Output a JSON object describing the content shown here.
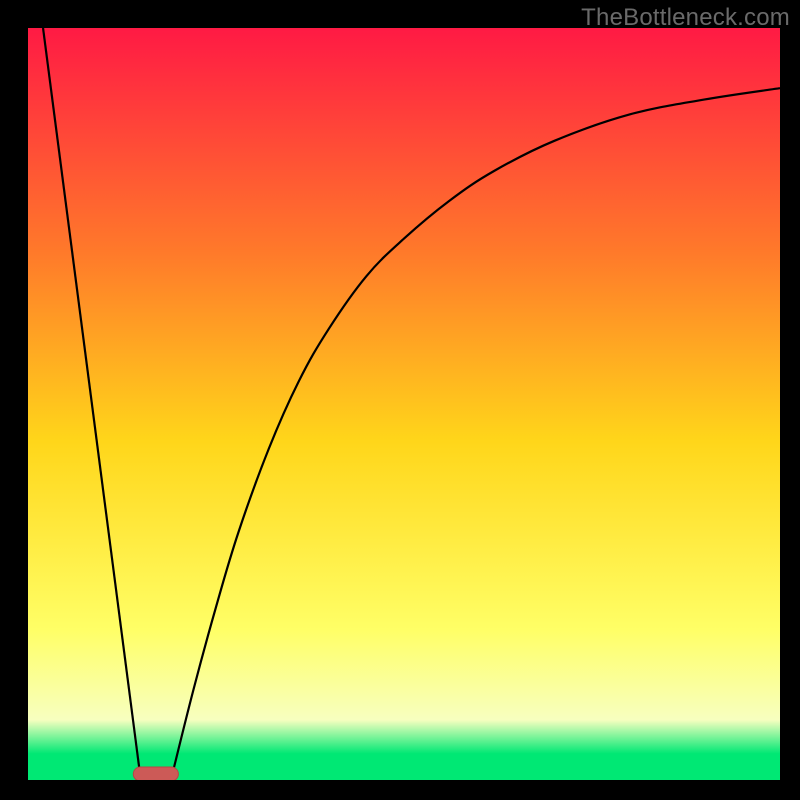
{
  "watermark": "TheBottleneck.com",
  "colors": {
    "frame": "#000000",
    "watermark_text": "#6a6a6a",
    "gradient_top": "#ff1a44",
    "gradient_mid_upper": "#ff7a2a",
    "gradient_mid": "#ffd61a",
    "gradient_mid_lower": "#ffff66",
    "gradient_lower": "#f7ffbf",
    "gradient_bottom": "#00e874",
    "curve": "#000000",
    "marker_fill": "#cc5a57",
    "marker_stroke": "#b64744"
  },
  "chart_data": {
    "type": "line",
    "title": "",
    "xlabel": "",
    "ylabel": "",
    "xlim": [
      0,
      100
    ],
    "ylim": [
      0,
      100
    ],
    "marker": {
      "x_center": 17,
      "width": 6,
      "y": 0
    },
    "series": [
      {
        "name": "left-segment",
        "x": [
          2,
          15
        ],
        "y": [
          100,
          0
        ]
      },
      {
        "name": "right-segment",
        "x": [
          19,
          22,
          25,
          28,
          32,
          36,
          40,
          45,
          50,
          56,
          62,
          70,
          80,
          90,
          100
        ],
        "y": [
          0,
          12,
          23,
          33,
          44,
          53,
          60,
          67,
          72,
          77,
          81,
          85,
          88.5,
          90.5,
          92
        ]
      }
    ],
    "gradient_stops": [
      {
        "offset": 0.0,
        "key": "gradient_top"
      },
      {
        "offset": 0.3,
        "key": "gradient_mid_upper"
      },
      {
        "offset": 0.55,
        "key": "gradient_mid"
      },
      {
        "offset": 0.8,
        "key": "gradient_mid_lower"
      },
      {
        "offset": 0.92,
        "key": "gradient_lower"
      },
      {
        "offset": 0.965,
        "key": "gradient_bottom"
      },
      {
        "offset": 1.0,
        "key": "gradient_bottom"
      }
    ]
  }
}
